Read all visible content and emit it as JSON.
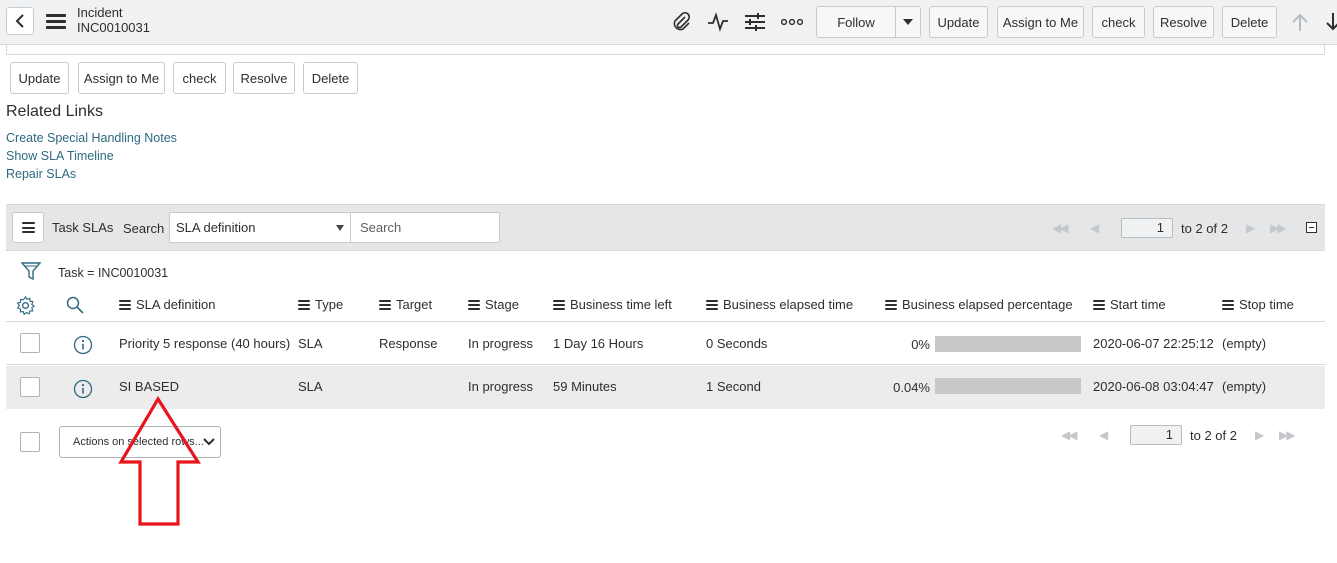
{
  "header": {
    "title": "Incident",
    "number": "INC0010031",
    "follow_label": "Follow",
    "buttons": [
      "Update",
      "Assign to Me",
      "check",
      "Resolve",
      "Delete"
    ]
  },
  "form_buttons": [
    "Update",
    "Assign to Me",
    "check",
    "Resolve",
    "Delete"
  ],
  "related_links": {
    "title": "Related Links",
    "links": [
      "Create Special Handling Notes",
      "Show SLA Timeline",
      "Repair SLAs"
    ]
  },
  "list": {
    "title": "Task SLAs",
    "search_label": "Search",
    "search_field": "SLA definition",
    "search_placeholder": "Search",
    "page": "1",
    "page_range": "to 2 of 2",
    "filter": "Task = INC0010031",
    "columns": [
      "SLA definition",
      "Type",
      "Target",
      "Stage",
      "Business time left",
      "Business elapsed time",
      "Business elapsed percentage",
      "Start time",
      "Stop time"
    ],
    "rows": [
      {
        "sla_definition": "Priority 5 response (40 hours)",
        "type": "SLA",
        "target": "Response",
        "stage": "In progress",
        "time_left": "1 Day 16 Hours",
        "elapsed_time": "0 Seconds",
        "elapsed_percentage": "0%",
        "elapsed_fraction": 0.0,
        "start_time": "2020-06-07 22:25:12",
        "stop_time": "(empty)"
      },
      {
        "sla_definition": "SI BASED",
        "type": "SLA",
        "target": "",
        "stage": "In progress",
        "time_left": "59 Minutes",
        "elapsed_time": "1 Second",
        "elapsed_percentage": "0.04%",
        "elapsed_fraction": 0.0004,
        "start_time": "2020-06-08 03:04:47",
        "stop_time": "(empty)"
      }
    ],
    "actions_label": "Actions on selected rows...",
    "footer_page": "1",
    "footer_page_range": "to 2 of 2"
  },
  "colors": {
    "link": "#2e6a80",
    "annotation_arrow": "#e8141b",
    "progress_track": "#c8c8c8",
    "header_bg": "#f0f1f2"
  },
  "icons": {
    "back": "chevron-left-icon",
    "menu": "hamburger-icon",
    "attachment": "paperclip-icon",
    "activity": "pulse-icon",
    "settings": "sliders-icon",
    "more": "more-dots-icon",
    "settings_gear": "gear-icon",
    "search": "search-icon",
    "filter": "funnel-icon",
    "info": "info-icon"
  }
}
